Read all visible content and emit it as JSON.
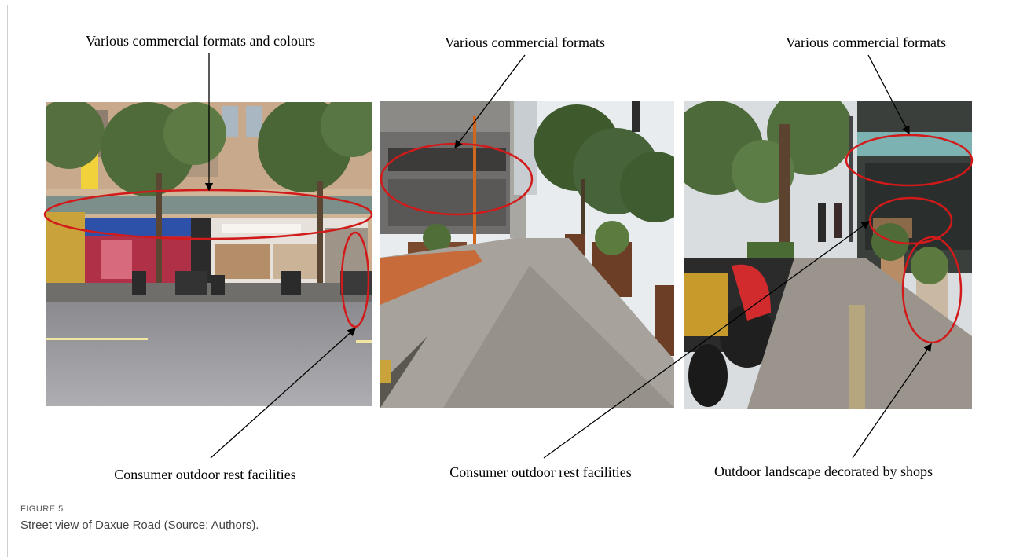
{
  "figure": {
    "labels": {
      "top_left": "Various commercial formats and colours",
      "top_middle": "Various commercial formats",
      "top_right": "Various commercial formats",
      "bottom_left": "Consumer outdoor rest facilities",
      "bottom_middle": "Consumer outdoor rest facilities",
      "bottom_right": "Outdoor landscape decorated by shops"
    },
    "annotation_color": "#d21a1a"
  },
  "caption": {
    "label": "FIGURE 5",
    "text": "Street view of Daxue Road (Source: Authors)."
  }
}
